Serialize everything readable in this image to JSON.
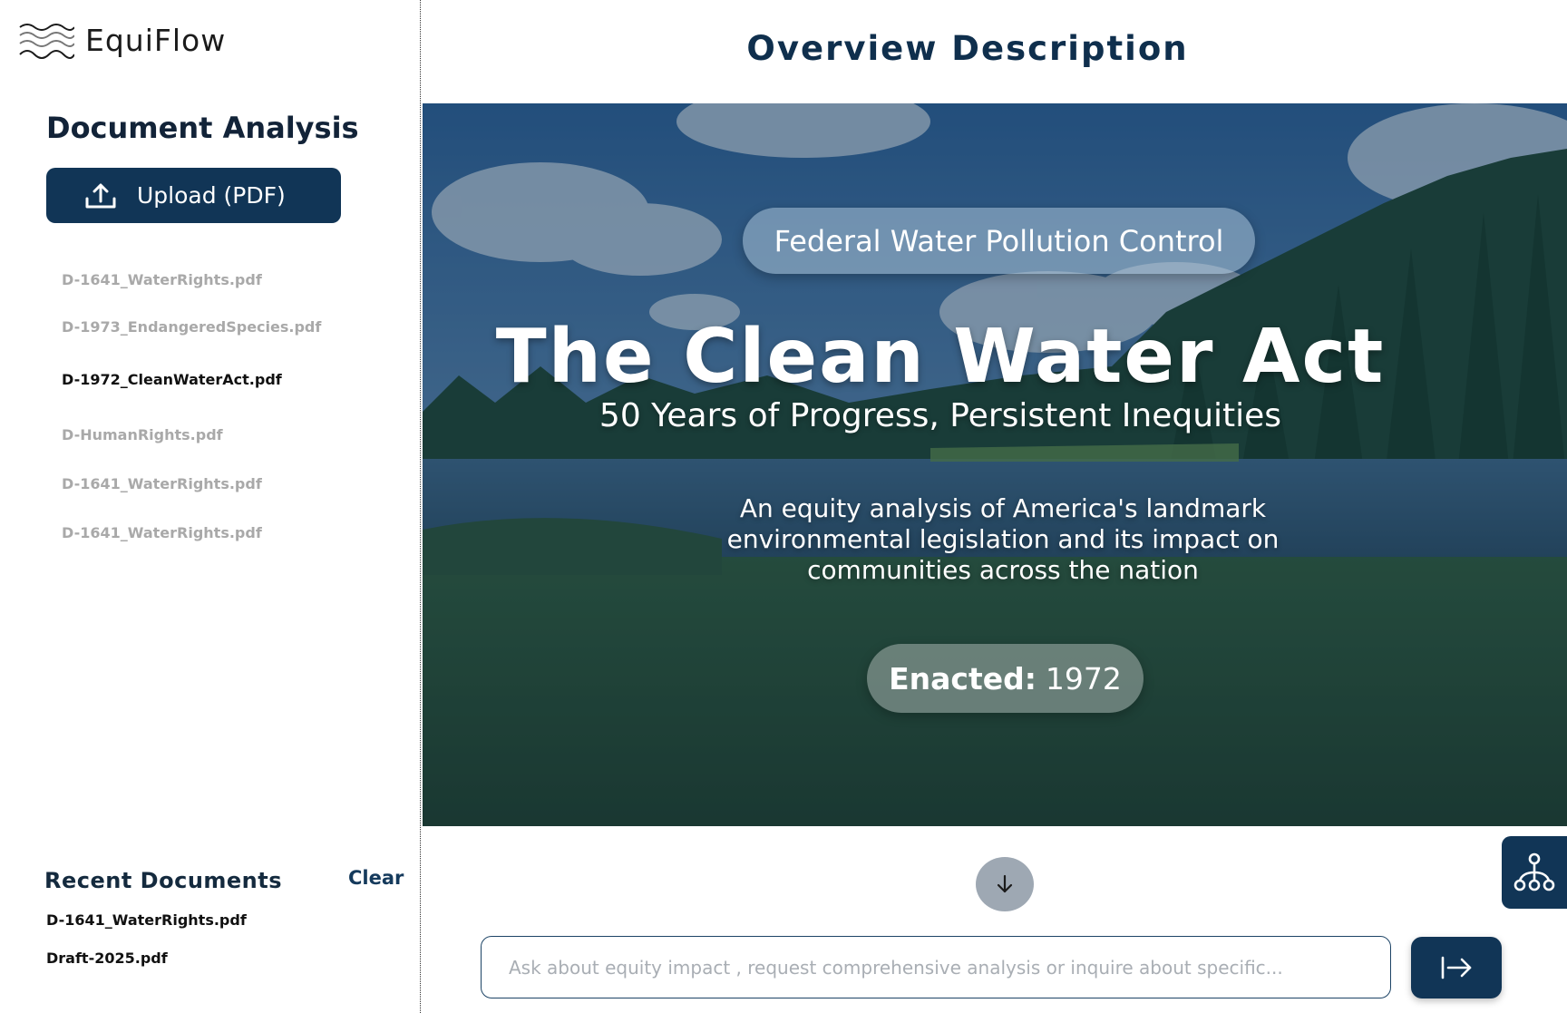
{
  "brand": {
    "name": "EquiFlow"
  },
  "sidebar": {
    "section_title": "Document Analysis",
    "upload_label": "Upload (PDF)",
    "documents": [
      {
        "name": "D-1641_WaterRights.pdf",
        "active": false
      },
      {
        "name": "D-1973_EndangeredSpecies.pdf",
        "active": false
      },
      {
        "name": "D-1972_CleanWaterAct.pdf",
        "active": true
      },
      {
        "name": "D-HumanRights.pdf",
        "active": false
      },
      {
        "name": "D-1641_WaterRights.pdf",
        "active": false
      },
      {
        "name": "D-1641_WaterRights.pdf",
        "active": false
      }
    ],
    "recent": {
      "title": "Recent Documents",
      "clear_label": "Clear",
      "items": [
        "D-1641_WaterRights.pdf",
        "Draft-2025.pdf"
      ]
    }
  },
  "main": {
    "title": "Overview Description",
    "hero": {
      "tag": "Federal Water Pollution Control",
      "title": "The Clean Water Act",
      "subtitle": "50 Years of Progress, Persistent Inequities",
      "description_lines": [
        "An equity analysis of America's landmark",
        "environmental legislation and its impact on",
        "communities across the nation"
      ],
      "enacted_label": "Enacted:",
      "enacted_year": "1972"
    },
    "chat": {
      "placeholder": "Ask about equity impact , request comprehensive analysis or inquire about specific..."
    }
  },
  "colors": {
    "accent": "#113556",
    "title": "#0f2f4d",
    "inactive_text": "#a9a9a9"
  },
  "icons": {
    "brand": "waves-icon",
    "upload": "upload-icon",
    "scroll": "arrow-down-icon",
    "diagram": "hierarchy-icon",
    "send": "send-arrow-icon"
  }
}
